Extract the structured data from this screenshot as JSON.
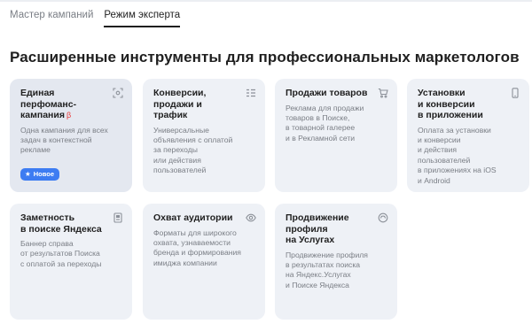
{
  "tabs": [
    {
      "label": "Мастер кампаний",
      "active": false
    },
    {
      "label": "Режим эксперта",
      "active": true
    }
  ],
  "heading": "Расширенные инструменты для профессиональных маркетологов",
  "cards": [
    {
      "title": "Единая\nперфоманс-\nкампания",
      "beta": "β",
      "desc": "Одна кампания для всех\nзадач в контекстной\nрекламе",
      "icon": "scan-target-icon",
      "badge": {
        "icon": "star-icon",
        "label": "Новое"
      }
    },
    {
      "title": "Конверсии,\nпродажи и трафик",
      "desc": "Универсальные\nобъявления с оплатой\nза переходы\nили действия\nпользователей",
      "icon": "list-icon"
    },
    {
      "title": "Продажи товаров",
      "desc": "Реклама для продажи\nтоваров в Поиске,\nв товарной галерее\nи в Рекламной сети",
      "icon": "cart-icon"
    },
    {
      "title": "Установки\nи конверсии\nв приложении",
      "desc": "Оплата за установки\nи конверсии\nи действия\nпользователей\nв приложениях на iOS\nи Android",
      "icon": "phone-icon"
    },
    {
      "title": "Заметность\nв поиске Яндекса",
      "desc": "Баннер справа\nот результатов Поиска\nс оплатой за переходы",
      "icon": "banner-icon"
    },
    {
      "title": "Охват аудитории",
      "desc": "Форматы для широкого\nохвата, узнаваемости\nбренда и формирования\nимиджа компании",
      "icon": "eye-icon"
    },
    {
      "title": "Продвижение\nпрофиля\nна Услугах",
      "desc": "Продвижение профиля\nв результатах поиска\nна Яндекс.Услугах\nи Поиске Яндекса",
      "icon": "services-icon"
    }
  ],
  "colors": {
    "card_bg": "#eef1f6",
    "accent": "#3d7cf2",
    "beta": "#e83a3a",
    "muted": "#7a7e85"
  }
}
